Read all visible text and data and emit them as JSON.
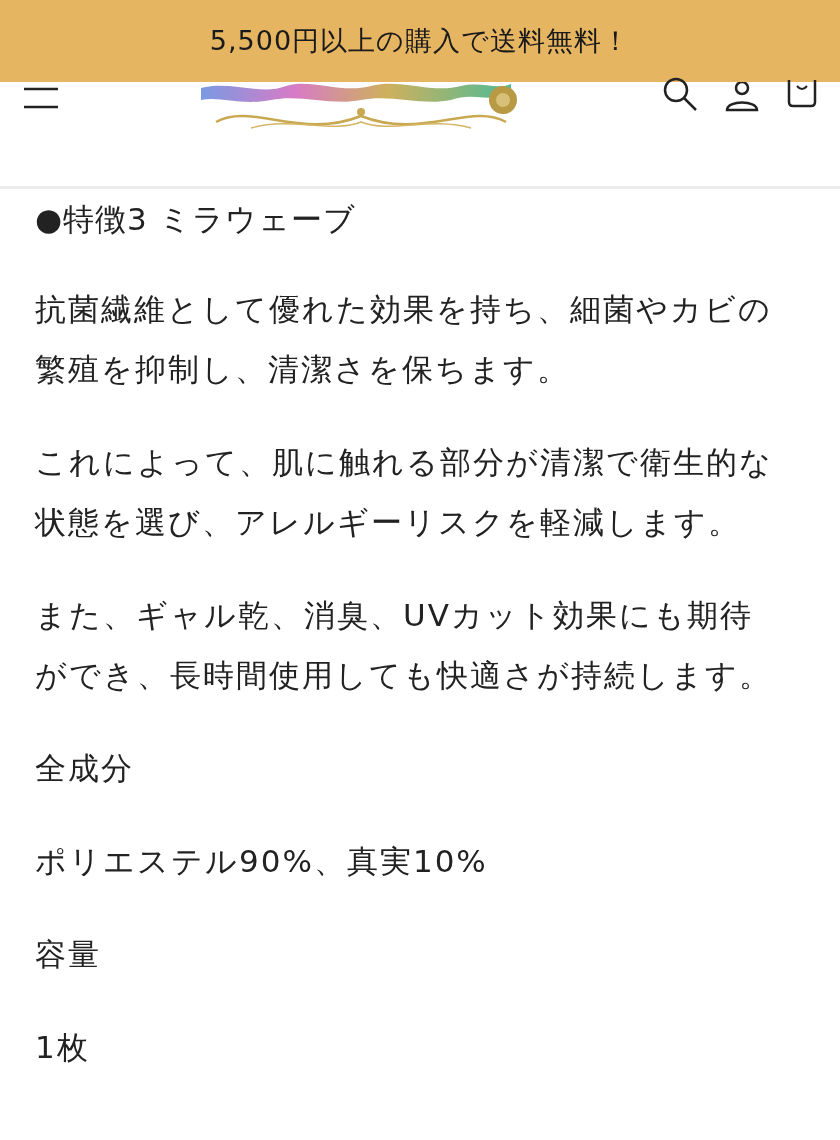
{
  "announcement": "5,500円以上の購入で送料無料！",
  "content": [
    {
      "kind": "heading",
      "text": "●特徴3 ミラウェーブ"
    },
    {
      "kind": "paragraph",
      "text": "抗菌繊維として優れた効果を持ち、細菌やカビの繁殖を抑制し、清潔さを保ちます。"
    },
    {
      "kind": "paragraph",
      "text": "これによって、肌に触れる部分が清潔で衛生的な状態を選び、アレルギーリスクを軽減します。"
    },
    {
      "kind": "paragraph",
      "text": "また、ギャル乾、消臭、UVカット効果にも期待ができ、長時間使用しても快適さが持続します。"
    },
    {
      "kind": "paragraph",
      "text": "全成分"
    },
    {
      "kind": "paragraph",
      "text": "ポリエステル90%、真実10%"
    },
    {
      "kind": "paragraph",
      "text": "容量"
    },
    {
      "kind": "paragraph",
      "text": "1枚"
    }
  ]
}
